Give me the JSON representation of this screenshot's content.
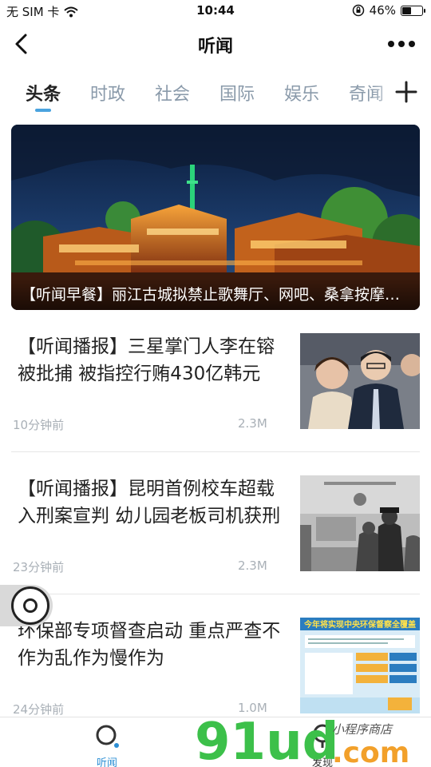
{
  "status_bar": {
    "carrier": "无 SIM 卡",
    "time": "10:44",
    "battery_percent": "46%",
    "battery_level": 0.46
  },
  "nav": {
    "title": "听闻",
    "back_icon": "chevron-left-icon",
    "more_icon": "more-dots-icon"
  },
  "tabs": [
    {
      "label": "头条",
      "active": true
    },
    {
      "label": "时政",
      "active": false
    },
    {
      "label": "社会",
      "active": false
    },
    {
      "label": "国际",
      "active": false
    },
    {
      "label": "娱乐",
      "active": false
    },
    {
      "label": "奇闻",
      "active": false
    }
  ],
  "banner": {
    "caption": "【听闻早餐】丽江古城拟禁止歌舞厅、网吧、桑拿按摩…"
  },
  "news": [
    {
      "title": "【听闻播报】三星掌门人李在镕被批捕 被指控行贿430亿韩元",
      "time": "10分钟前",
      "count": "2.3M"
    },
    {
      "title": "【听闻播报】昆明首例校车超载入刑案宣判 幼儿园老板司机获刑",
      "time": "23分钟前",
      "count": "2.3M"
    },
    {
      "title": "环保部专项督查启动 重点严查不作为乱作为慢作为",
      "time": "24分钟前",
      "count": "1.0M",
      "thumb_headline": "今年将实现中央环保督察全覆盖"
    }
  ],
  "bottom_tabs": [
    {
      "label": "听闻",
      "icon": "search-ring-icon",
      "active": true
    },
    {
      "label": "发现",
      "icon": "discover-icon",
      "active": false
    }
  ],
  "watermark": {
    "brand": "91ud.com",
    "tagline": "小程序商店"
  },
  "colors": {
    "accent": "#2d8fd5",
    "tab_indicator": "#4aa3df",
    "tab_inactive": "#8a9aaa",
    "watermark_green": "#3cc04a",
    "watermark_orange": "#f2a02a"
  }
}
